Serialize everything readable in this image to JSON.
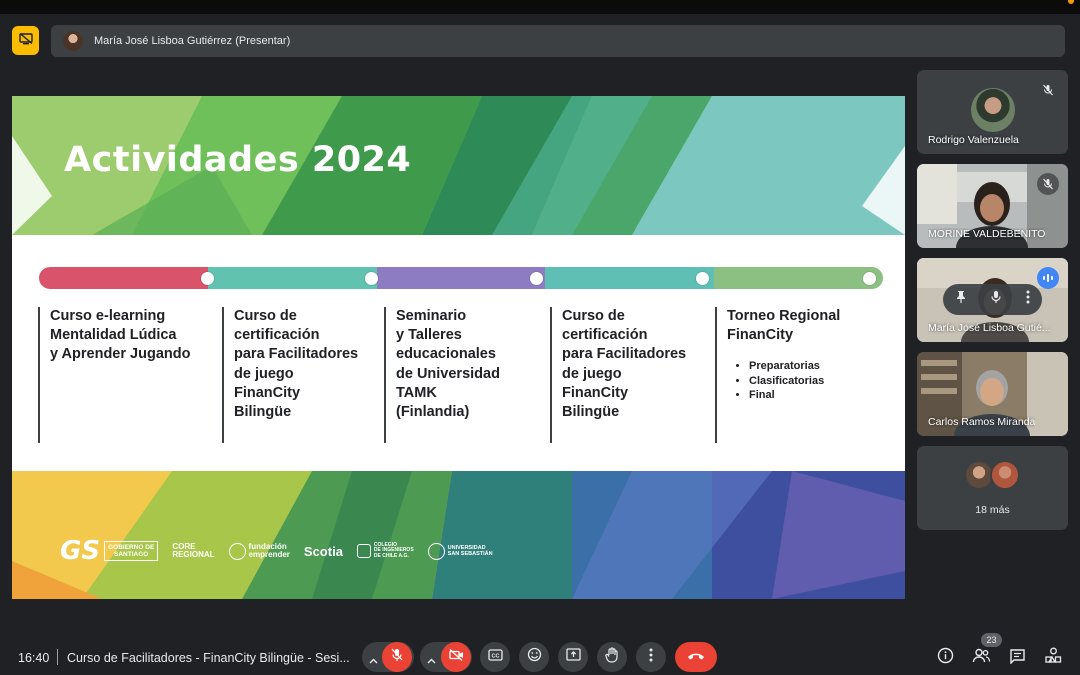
{
  "presentation": {
    "presenter_label": "María José Lisboa Gutiérrez (Presentar)",
    "stop_presenting_icon": "present-off-icon"
  },
  "slide": {
    "title": "Actividades 2024",
    "timeline_colors": [
      "#d9536a",
      "#62c2b0",
      "#8e7cc3",
      "#5fbfb5",
      "#8cc083"
    ],
    "columns": [
      {
        "title": "Curso e-learning\nMentalidad Lúdica\ny Aprender Jugando",
        "items": []
      },
      {
        "title": "Curso de\ncertificación\npara Facilitadores\nde juego\nFinanCity\nBilingüe",
        "items": []
      },
      {
        "title": "Seminario\ny Talleres\neducacionales\nde Universidad\nTAMK\n(Finlandia)",
        "items": []
      },
      {
        "title": "Curso de\ncertificación\npara Facilitadores\nde juego\nFinanCity\nBilingüe",
        "items": []
      },
      {
        "title": "Torneo Regional\nFinanCity",
        "items": [
          "Preparatorias",
          "Clasificatorias",
          "Final"
        ]
      }
    ],
    "logos": {
      "gs": "GS",
      "gobierno": "GOBIERNO DE\nSANTIAGO",
      "core": "CORE\nREGIONAL",
      "fundacion": "fundación\nemprender",
      "scotia": "Scotia",
      "colegio": "COLEGIO\nDE INGENIEROS\nDE CHILE A.G.",
      "universidad": "UNIVERSIDAD\nSAN SEBASTIÁN"
    }
  },
  "participants": [
    {
      "name": "Rodrigo Valenzuela",
      "muted": true,
      "icon": "mic-off-icon"
    },
    {
      "name": "MORINE VALDEBENITO",
      "muted": true,
      "icon": "mic-off-icon"
    },
    {
      "name": "María José Lisboa Gutié...",
      "speaking": true,
      "icon": "audio-level-icon"
    },
    {
      "name": "Carlos Ramos Miranda",
      "muted": false
    }
  ],
  "more_participants": {
    "label": "18 más"
  },
  "tile_controls": {
    "pin_icon": "pin-icon",
    "mic_icon": "mic-icon",
    "more_icon": "more-vert-icon"
  },
  "bottom_bar": {
    "time": "16:40",
    "meeting_title": "Curso de Facilitadores - FinanCity Bilingüe - Sesi...",
    "buttons": {
      "mic": "mic-off-icon",
      "camera": "camera-off-icon",
      "captions": "captions-icon",
      "emoji": "emoji-icon",
      "present": "present-screen-icon",
      "hand": "raise-hand-icon",
      "more": "more-vert-icon",
      "leave": "call-end-icon"
    },
    "people_count": "23",
    "accent_red": "#ea4335",
    "accent_yellow": "#fbbc04"
  }
}
